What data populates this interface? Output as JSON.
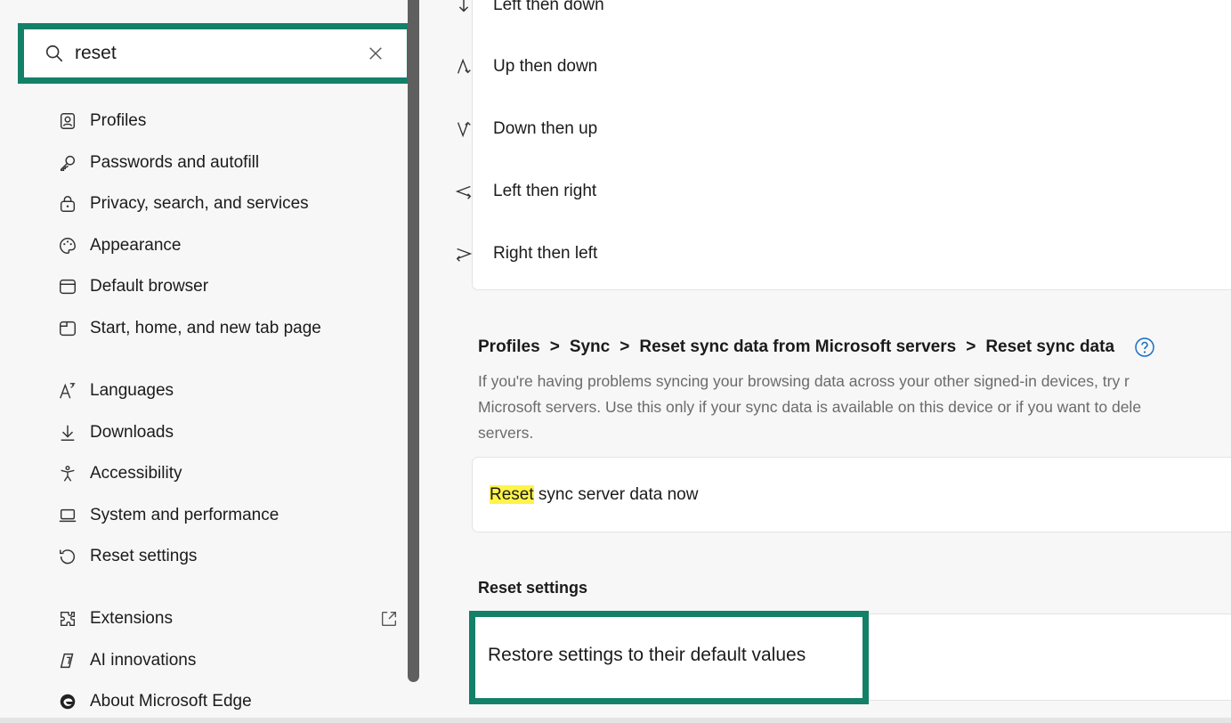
{
  "search": {
    "value": "reset",
    "placeholder": ""
  },
  "sidebar": {
    "items": [
      {
        "label": "Profiles",
        "icon": "profiles-icon"
      },
      {
        "label": "Passwords and autofill",
        "icon": "key-icon"
      },
      {
        "label": "Privacy, search, and services",
        "icon": "lock-icon"
      },
      {
        "label": "Appearance",
        "icon": "palette-icon"
      },
      {
        "label": "Default browser",
        "icon": "browser-icon"
      },
      {
        "label": "Start, home, and new tab page",
        "icon": "home-tab-icon"
      },
      {
        "label": "Languages",
        "icon": "language-icon"
      },
      {
        "label": "Downloads",
        "icon": "download-icon"
      },
      {
        "label": "Accessibility",
        "icon": "accessibility-icon"
      },
      {
        "label": "System and performance",
        "icon": "laptop-icon"
      },
      {
        "label": "Reset settings",
        "icon": "reset-icon"
      },
      {
        "label": "Extensions",
        "icon": "puzzle-icon"
      },
      {
        "label": "AI innovations",
        "icon": "ai-icon"
      },
      {
        "label": "About Microsoft Edge",
        "icon": "edge-logo-icon"
      }
    ]
  },
  "gestures": [
    {
      "label": "Left then down",
      "icon": "gesture-left-down-icon"
    },
    {
      "label": "Up then down",
      "icon": "gesture-up-down-icon"
    },
    {
      "label": "Down then up",
      "icon": "gesture-down-up-icon"
    },
    {
      "label": "Left then right",
      "icon": "gesture-left-right-icon"
    },
    {
      "label": "Right then left",
      "icon": "gesture-right-left-icon"
    }
  ],
  "sync_section": {
    "breadcrumb": [
      "Profiles",
      "Sync",
      "Reset sync data from Microsoft servers",
      "Reset sync data"
    ],
    "separator": ">",
    "description_lines": [
      "If you're having problems syncing your browsing data across your other signed-in devices, try r",
      "Microsoft servers. Use this only if your sync data is available on this device or if you want to dele",
      "servers."
    ],
    "row_highlight": "Reset",
    "row_rest": " sync server data now"
  },
  "reset_section": {
    "title": "Reset settings",
    "row_label": "Restore settings to their default values"
  },
  "colors": {
    "focus_outline": "#138068",
    "highlight": "#fff34a",
    "secondary_text": "#6b6b6b"
  }
}
